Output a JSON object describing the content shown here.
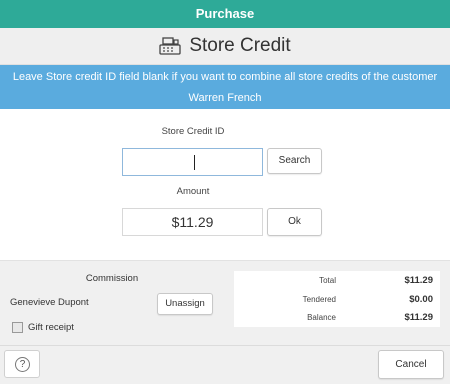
{
  "window": {
    "title": "Purchase"
  },
  "header": {
    "title": "Store Credit",
    "icon": "cash-register-icon"
  },
  "info": {
    "line1": "Leave Store credit ID field blank if you want to combine all store credits of the customer",
    "line2": "Warren French"
  },
  "form": {
    "store_credit_id_label": "Store Credit ID",
    "store_credit_id_value": "",
    "search_label": "Search",
    "amount_label": "Amount",
    "amount_value": "$11.29",
    "ok_label": "Ok"
  },
  "commission": {
    "label": "Commission",
    "person": "Genevieve Dupont",
    "unassign_label": "Unassign",
    "gift_receipt_label": "Gift receipt",
    "gift_receipt_checked": false
  },
  "totals": {
    "total_label": "Total",
    "total_value": "$11.29",
    "tendered_label": "Tendered",
    "tendered_value": "$0.00",
    "balance_label": "Balance",
    "balance_value": "$11.29"
  },
  "footer": {
    "help_icon": "help-icon",
    "help_glyph": "?",
    "cancel_label": "Cancel"
  },
  "colors": {
    "titlebar": "#2eaa98",
    "infobar": "#5aabde",
    "input_focus_border": "#8fb8dc"
  }
}
